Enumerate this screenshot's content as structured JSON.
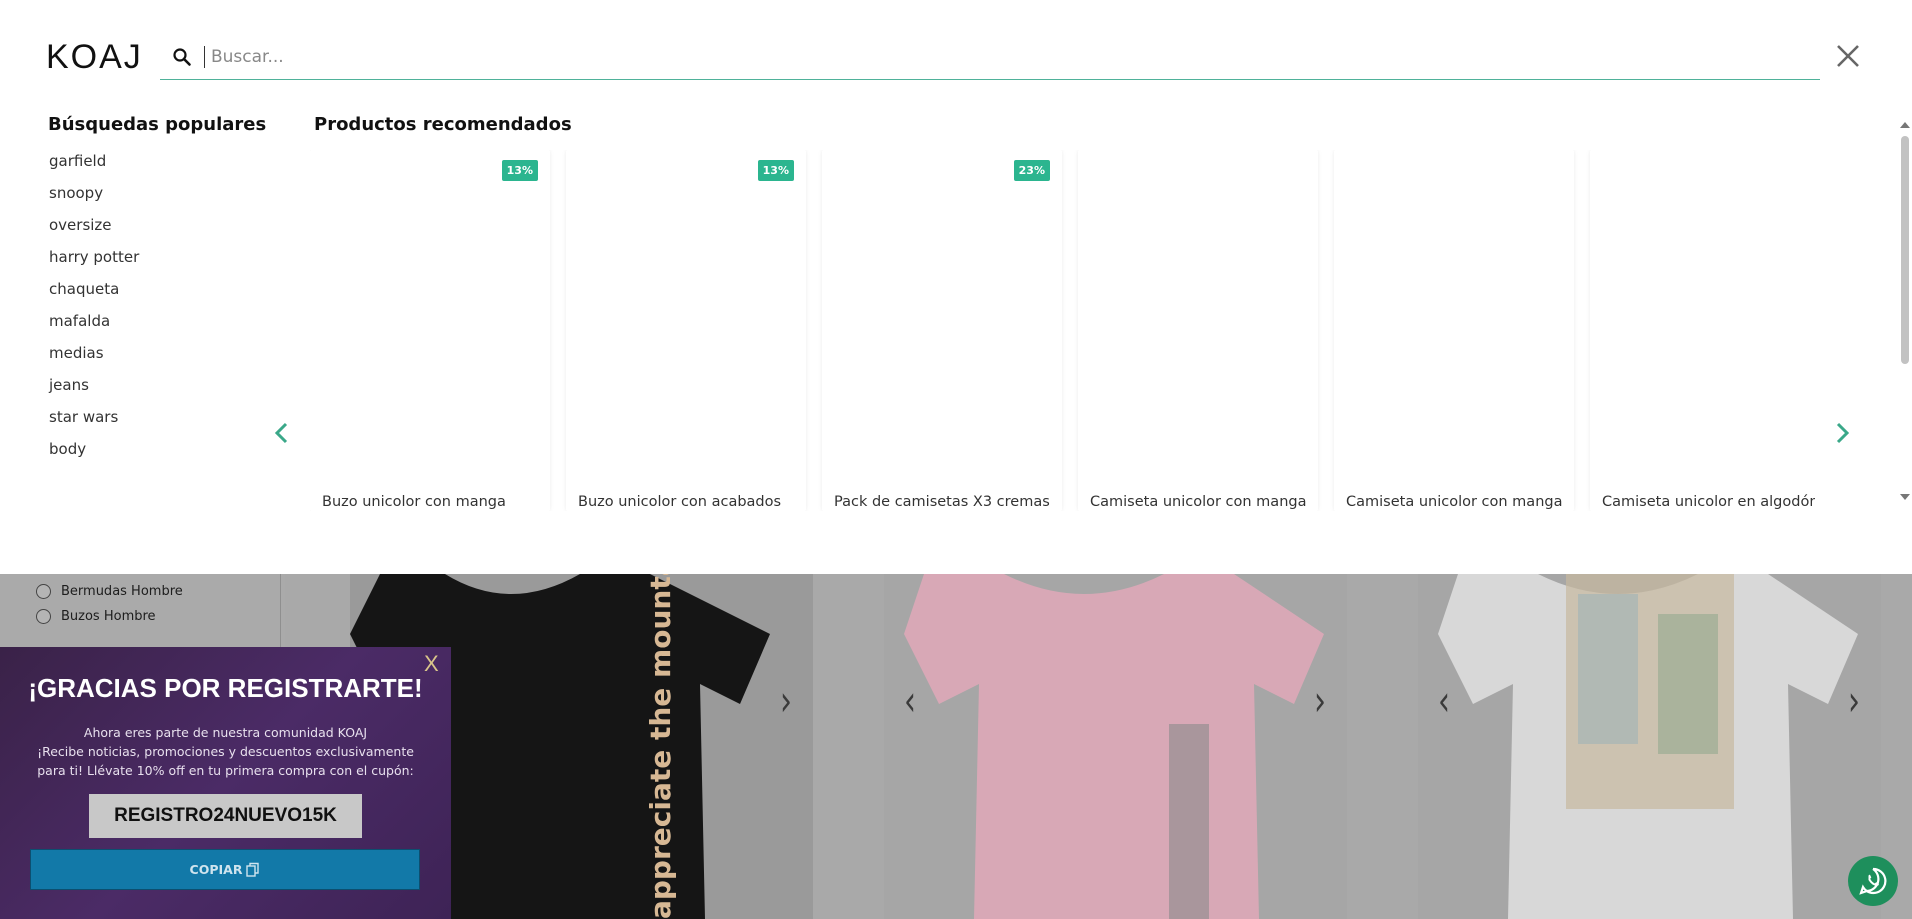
{
  "brand": {
    "logo_text": "KOAJ"
  },
  "search": {
    "placeholder": "Buscar..."
  },
  "popular": {
    "title": "Búsquedas populares",
    "items": [
      "garfield",
      "snoopy",
      "oversize",
      "harry potter",
      "chaqueta",
      "mafalda",
      "medias",
      "jeans",
      "star wars",
      "body"
    ]
  },
  "recommended": {
    "title": "Productos recomendados",
    "products": [
      {
        "name": "Buzo unicolor con manga",
        "badge": "13%"
      },
      {
        "name": "Buzo unicolor con acabados",
        "badge": "13%"
      },
      {
        "name": "Pack de camisetas X3 cremas",
        "badge": "23%"
      },
      {
        "name": "Camiseta unicolor con manga",
        "badge": ""
      },
      {
        "name": "Camiseta unicolor con manga",
        "badge": ""
      },
      {
        "name": "Camiseta unicolor en algodón",
        "badge": ""
      }
    ]
  },
  "background_filters": {
    "items": [
      "Bermudas Hombre",
      "Buzos Hombre"
    ]
  },
  "popup": {
    "close_label": "X",
    "title": "¡GRACIAS POR REGISTRARTE!",
    "line1": "Ahora eres parte de nuestra comunidad KOAJ",
    "line2": "¡Recibe noticias, promociones y descuentos exclusivamente",
    "line3": "para ti! Llévate 10% off en tu primera compra con el cupón:",
    "coupon_code": "REGISTRO24NUEVO15K",
    "copy_label": "COPIAR"
  },
  "icons": {
    "search": "search-icon",
    "close": "close-icon",
    "prev": "chevron-left-icon",
    "next": "chevron-right-icon",
    "copy": "copy-icon",
    "whatsapp": "whatsapp-icon"
  },
  "colors": {
    "accent": "#2bb58f",
    "popup_bg": "#4b2b66",
    "copy_button": "#1279a8",
    "whatsapp": "#1e8f5c"
  }
}
